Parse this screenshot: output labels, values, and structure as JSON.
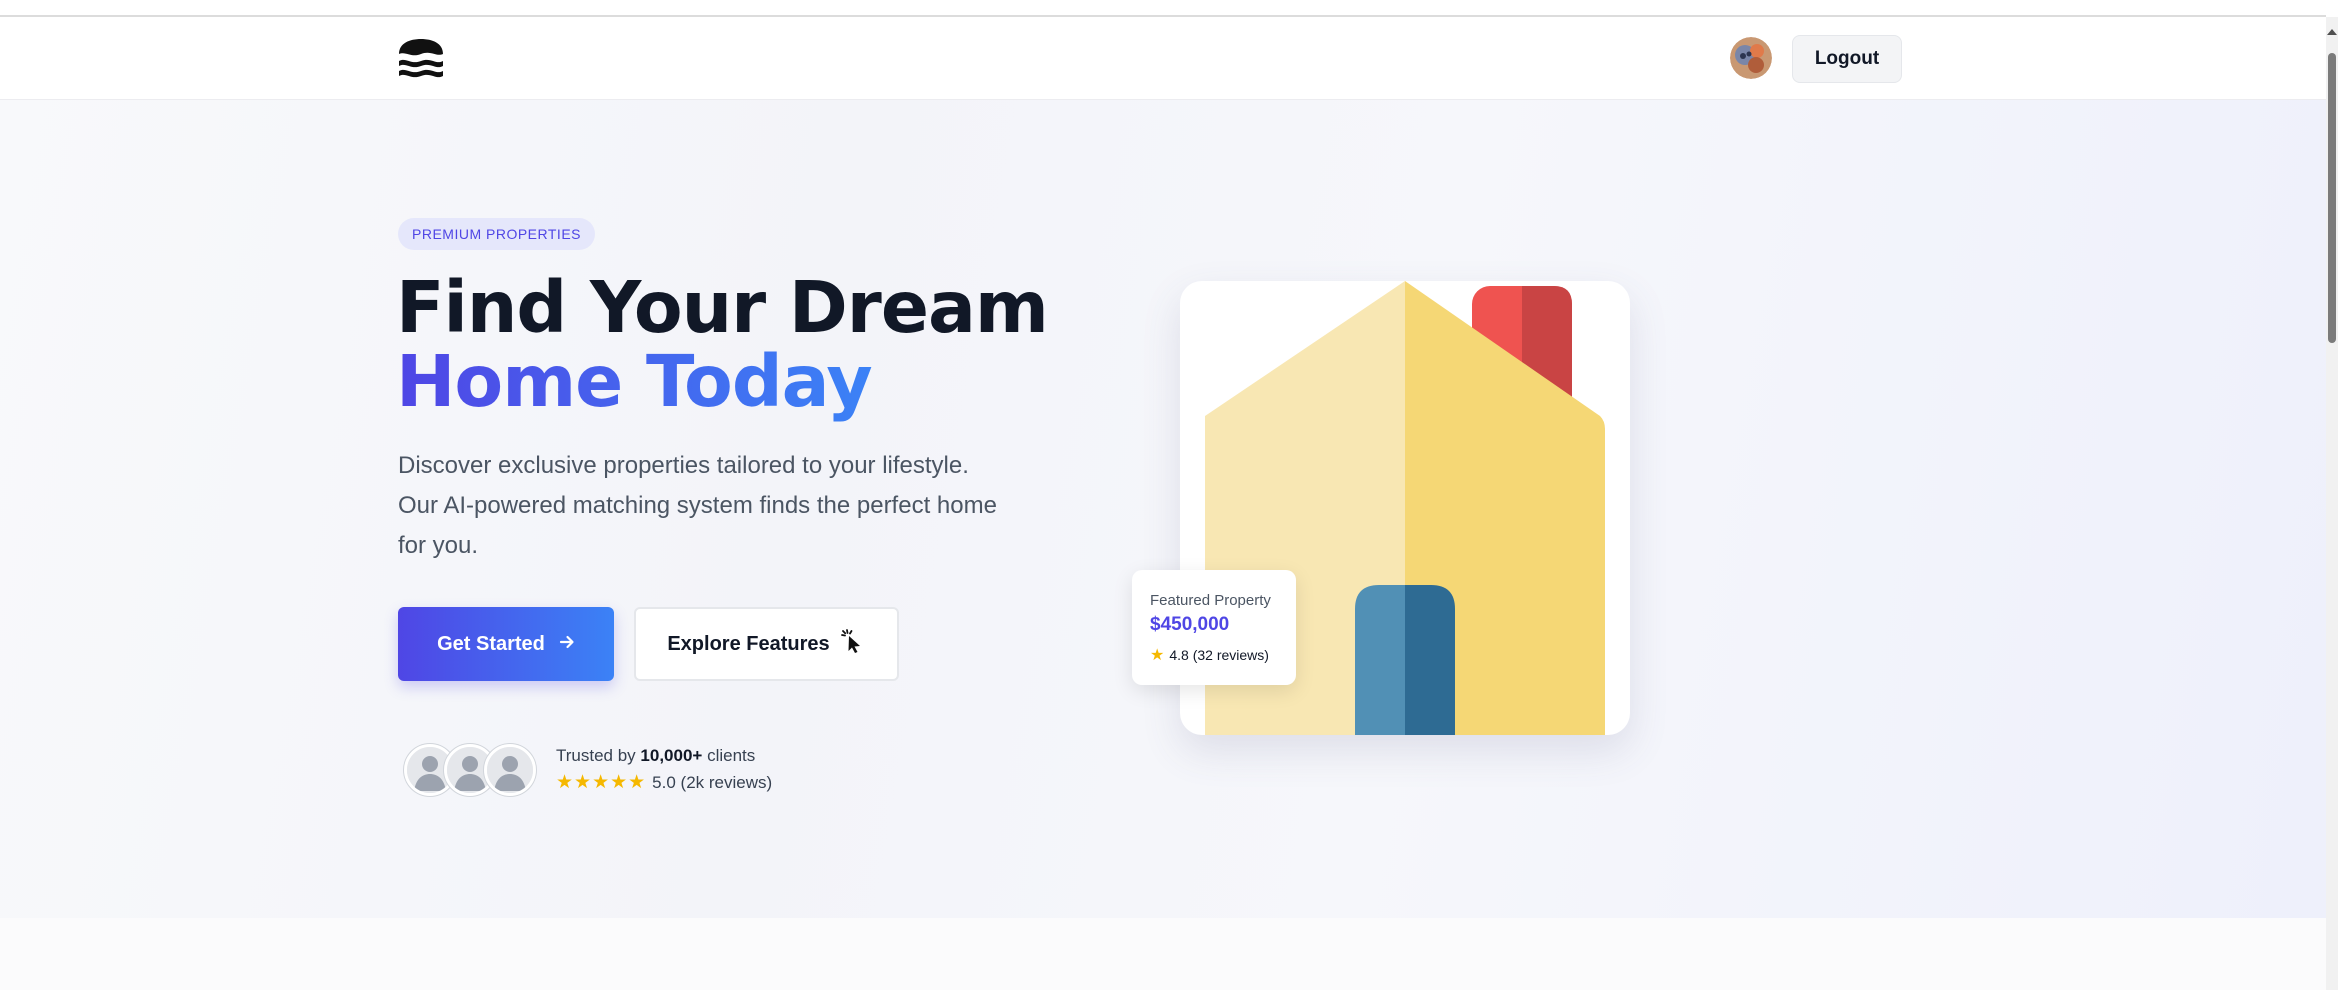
{
  "nav": {
    "logout_label": "Logout"
  },
  "hero": {
    "badge": "PREMIUM PROPERTIES",
    "title_line1": "Find Your Dream",
    "title_line2": "Home Today",
    "desc_lines": [
      "Discover exclusive properties tailored to your lifestyle.",
      "Our AI-powered matching system finds the perfect home",
      "for you."
    ],
    "primary_button": "Get Started",
    "secondary_button": "Explore Features",
    "trust_prefix": "Trusted by ",
    "trust_count": "10,000+",
    "trust_suffix": " clients",
    "rating_stars": "★★★★★",
    "rating_text": "5.0 (2k reviews)"
  },
  "featured": {
    "label": "Featured Property",
    "price": "$450,000",
    "star": "★",
    "reviews": "4.8 (32 reviews)"
  },
  "colors": {
    "accent": "#4f46e5",
    "accent_end": "#3b82f6",
    "star": "#f5b800",
    "house_wall": "#f5d775",
    "house_roof_light": "#f8e7b3",
    "chimney": "#ef5350",
    "door": "#2e6b93"
  },
  "icons": [
    "waves-logo-icon",
    "user-avatar-icon",
    "arrow-right-icon",
    "cursor-click-icon",
    "star-icon",
    "house-illustration"
  ]
}
